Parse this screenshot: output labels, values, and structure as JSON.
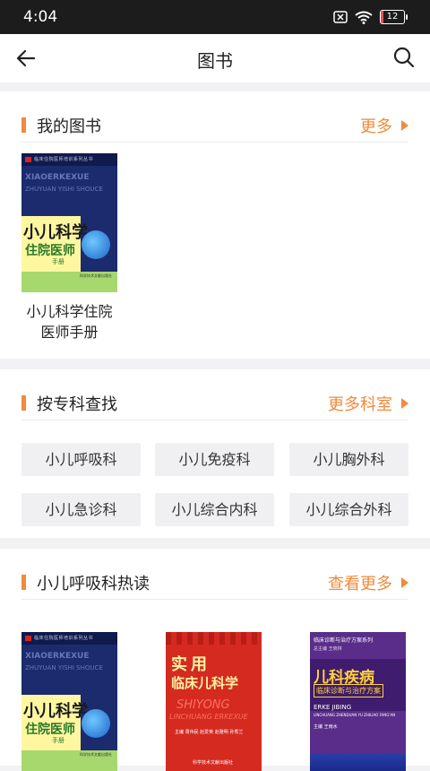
{
  "status": {
    "time": "4:04",
    "battery": "12",
    "battery_level": 0.12
  },
  "nav": {
    "title": "图书",
    "back_icon": "arrow-left-icon",
    "search_icon": "search-icon"
  },
  "my_books": {
    "label": "我的图书",
    "more": "更多",
    "books": [
      {
        "title": "小儿科学住院医师手册"
      }
    ]
  },
  "departments": {
    "label": "按专科查找",
    "more": "更多科室",
    "items": [
      "小儿呼吸科",
      "小儿免疫科",
      "小儿胸外科",
      "小儿急诊科",
      "小儿综合内科",
      "小儿综合外科"
    ]
  },
  "hot": {
    "label": "小儿呼吸科热读",
    "more": "查看更多"
  },
  "covers": {
    "c1": {
      "header": "临床住院医师培训系列丛书",
      "pinyin1": "XIAOERKEXUE",
      "pinyin2": "ZHUYUAN YISHI SHOUCE",
      "line1": "小儿科学",
      "line2": "住院医师",
      "line3": "手册",
      "publisher": "科学技术文献出版社"
    },
    "c2": {
      "big": "实用",
      "mid": "临床儿科学",
      "en1": "SHIYONG",
      "en2": "LINCHUANG ERKEXUE",
      "authors": "主编 周伟民 赵爱英 赵雅明 孙秀兰",
      "publisher": "科学技术文献出版社"
    },
    "c3": {
      "header": "临床诊断与治疗方案系列",
      "sub": "总主编 王晓林",
      "title": "儿科疾病",
      "subtitle": "临床诊断与治疗方案",
      "en1": "ERKE JIBING",
      "en2": "LINCHUANG ZHENDUAN YU ZHILIAO FANG'AN",
      "editor": "主编 王雨水"
    }
  },
  "colors": {
    "accent": "#f08a3c",
    "statusbar": "#1c1c1c",
    "page_bg": "#f2f2f4"
  }
}
